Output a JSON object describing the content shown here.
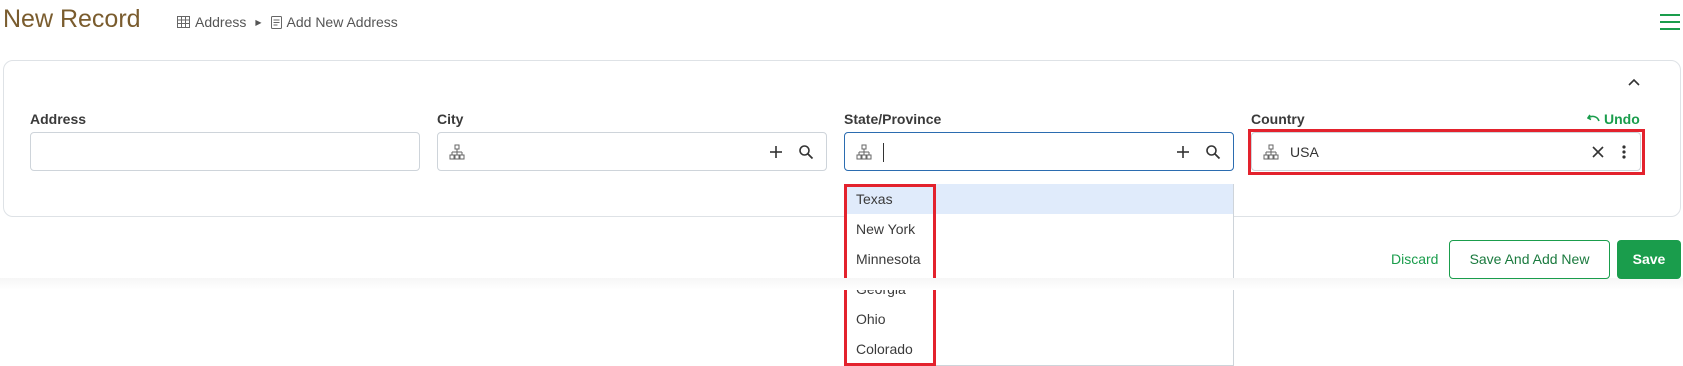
{
  "header": {
    "title": "New Record",
    "breadcrumb": [
      "Address",
      "Add New Address"
    ]
  },
  "form": {
    "address": {
      "label": "Address",
      "value": ""
    },
    "city": {
      "label": "City",
      "value": ""
    },
    "state": {
      "label": "State/Province",
      "value": ""
    },
    "country": {
      "label": "Country",
      "value": "USA"
    },
    "undo_label": "Undo"
  },
  "dropdown": {
    "options": [
      "Texas",
      "New York",
      "Minnesota",
      "Georgia",
      "Ohio",
      "Colorado"
    ],
    "active_index": 0
  },
  "actions": {
    "discard": "Discard",
    "save_and_add_new": "Save And Add New",
    "save": "Save"
  },
  "colors": {
    "accent": "#1a9d4c",
    "title": "#7a5c2e",
    "highlight": "#e3222d",
    "focus": "#2b6cb0"
  }
}
